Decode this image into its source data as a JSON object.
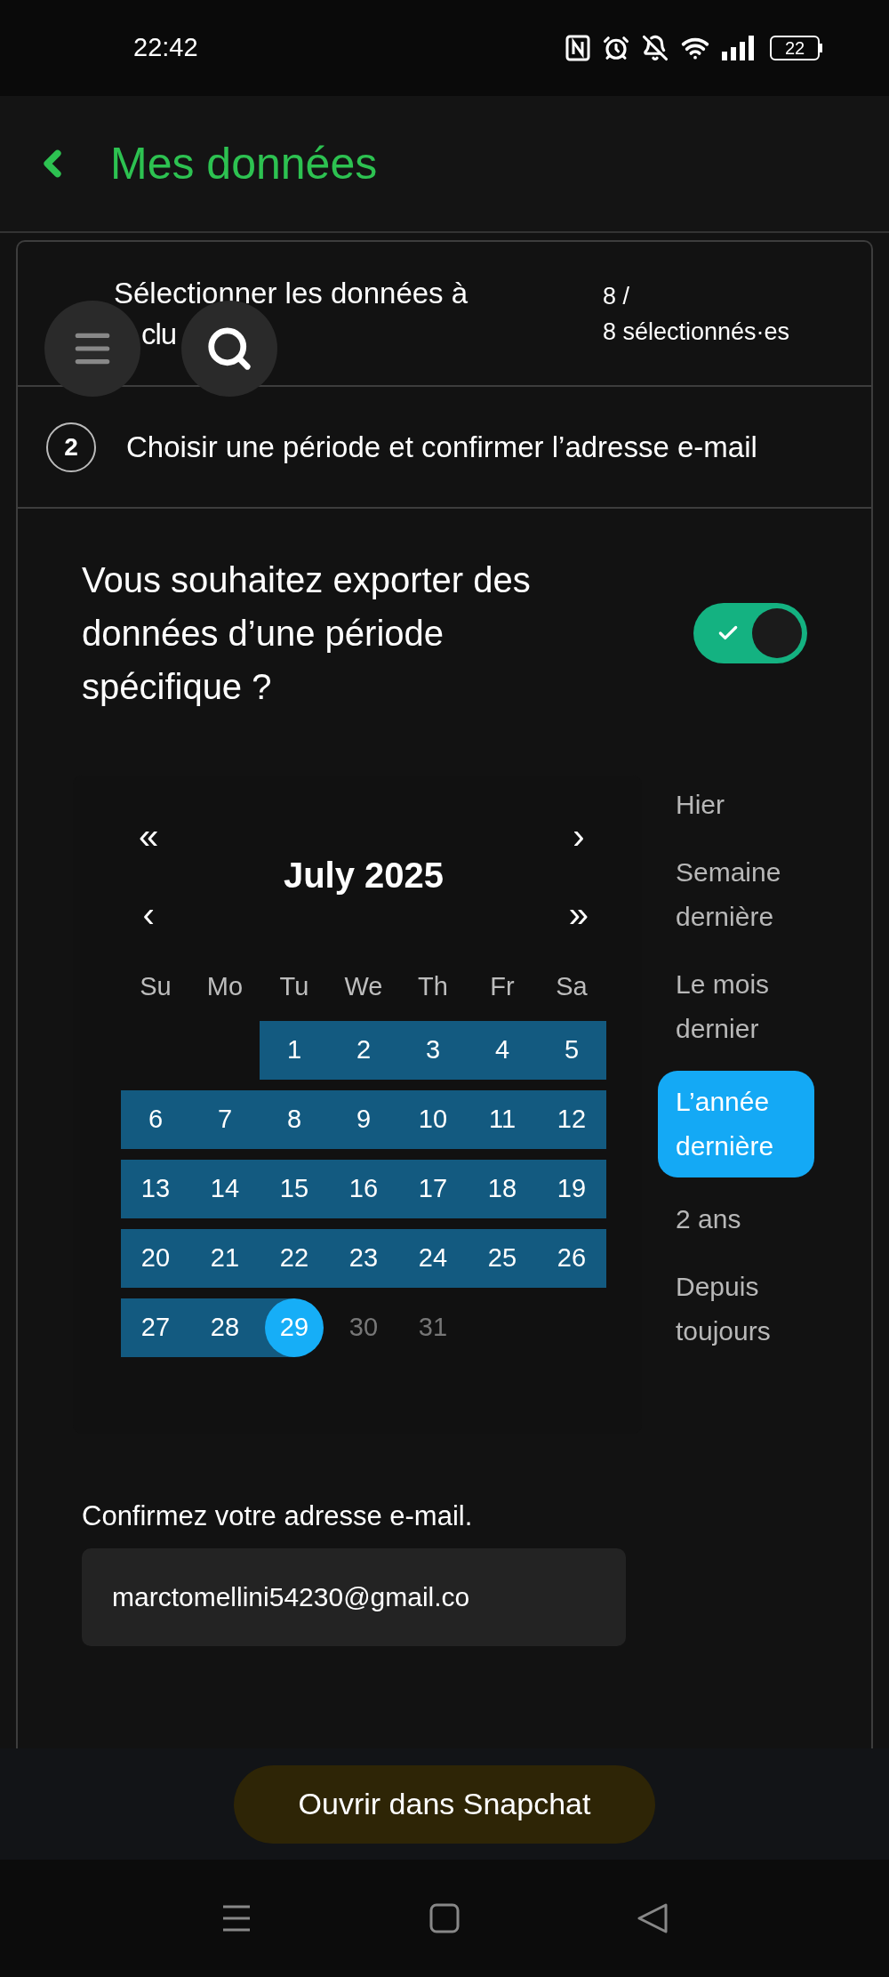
{
  "status_bar": {
    "time": "22:42",
    "battery": "22"
  },
  "header": {
    "title": "Mes données"
  },
  "steps": [
    {
      "lines": [
        "Sélectionner les données à",
        "clu"
      ],
      "count": [
        "8 /",
        "8 sélectionnés·es"
      ]
    },
    {
      "number": "2",
      "title": "Choisir une période et confirmer l’adresse e-mail"
    }
  ],
  "period_question": {
    "text": "Vous souhaitez exporter des données d’une période spécifique ?",
    "on": true
  },
  "calendar": {
    "title": "July 2025",
    "nav_top": [
      "«",
      "›"
    ],
    "nav_bottom": [
      "‹",
      "»"
    ],
    "weekdays": [
      "Su",
      "Mo",
      "Tu",
      "We",
      "Th",
      "Fr",
      "Sa"
    ],
    "weeks": [
      [
        {
          "day": "1",
          "kind": "range"
        },
        {
          "day": "2",
          "kind": "range"
        },
        {
          "day": "3",
          "kind": "range"
        },
        {
          "day": "4",
          "kind": "range"
        },
        {
          "day": "5",
          "kind": "range"
        }
      ],
      [
        {
          "day": "6",
          "kind": "range"
        },
        {
          "day": "7",
          "kind": "range"
        },
        {
          "day": "8",
          "kind": "range"
        },
        {
          "day": "9",
          "kind": "range"
        },
        {
          "day": "10",
          "kind": "range"
        },
        {
          "day": "11",
          "kind": "range"
        },
        {
          "day": "12",
          "kind": "range"
        }
      ],
      [
        {
          "day": "13",
          "kind": "range"
        },
        {
          "day": "14",
          "kind": "range"
        },
        {
          "day": "15",
          "kind": "range"
        },
        {
          "day": "16",
          "kind": "range"
        },
        {
          "day": "17",
          "kind": "range"
        },
        {
          "day": "18",
          "kind": "range"
        },
        {
          "day": "19",
          "kind": "range"
        }
      ],
      [
        {
          "day": "20",
          "kind": "range"
        },
        {
          "day": "21",
          "kind": "range"
        },
        {
          "day": "22",
          "kind": "range"
        },
        {
          "day": "23",
          "kind": "range"
        },
        {
          "day": "24",
          "kind": "range"
        },
        {
          "day": "25",
          "kind": "range"
        },
        {
          "day": "26",
          "kind": "range"
        }
      ],
      [
        {
          "day": "27",
          "kind": "range"
        },
        {
          "day": "28",
          "kind": "range"
        },
        {
          "day": "29",
          "kind": "end"
        },
        {
          "day": "30",
          "kind": "disabled"
        },
        {
          "day": "31",
          "kind": "disabled"
        }
      ]
    ]
  },
  "presets": [
    {
      "label": "Hier",
      "selected": false
    },
    {
      "label": "Semaine dernière",
      "selected": false
    },
    {
      "label": "Le mois dernier",
      "selected": false
    },
    {
      "label": "L’année dernière",
      "selected": true
    },
    {
      "label": "2 ans",
      "selected": false
    },
    {
      "label": "Depuis toujours",
      "selected": false
    }
  ],
  "email": {
    "label": "Confirmez votre adresse e-mail.",
    "value": "marctomellini54230@gmail.co"
  },
  "open_button": {
    "label": "Ouvrir dans Snapchat"
  }
}
